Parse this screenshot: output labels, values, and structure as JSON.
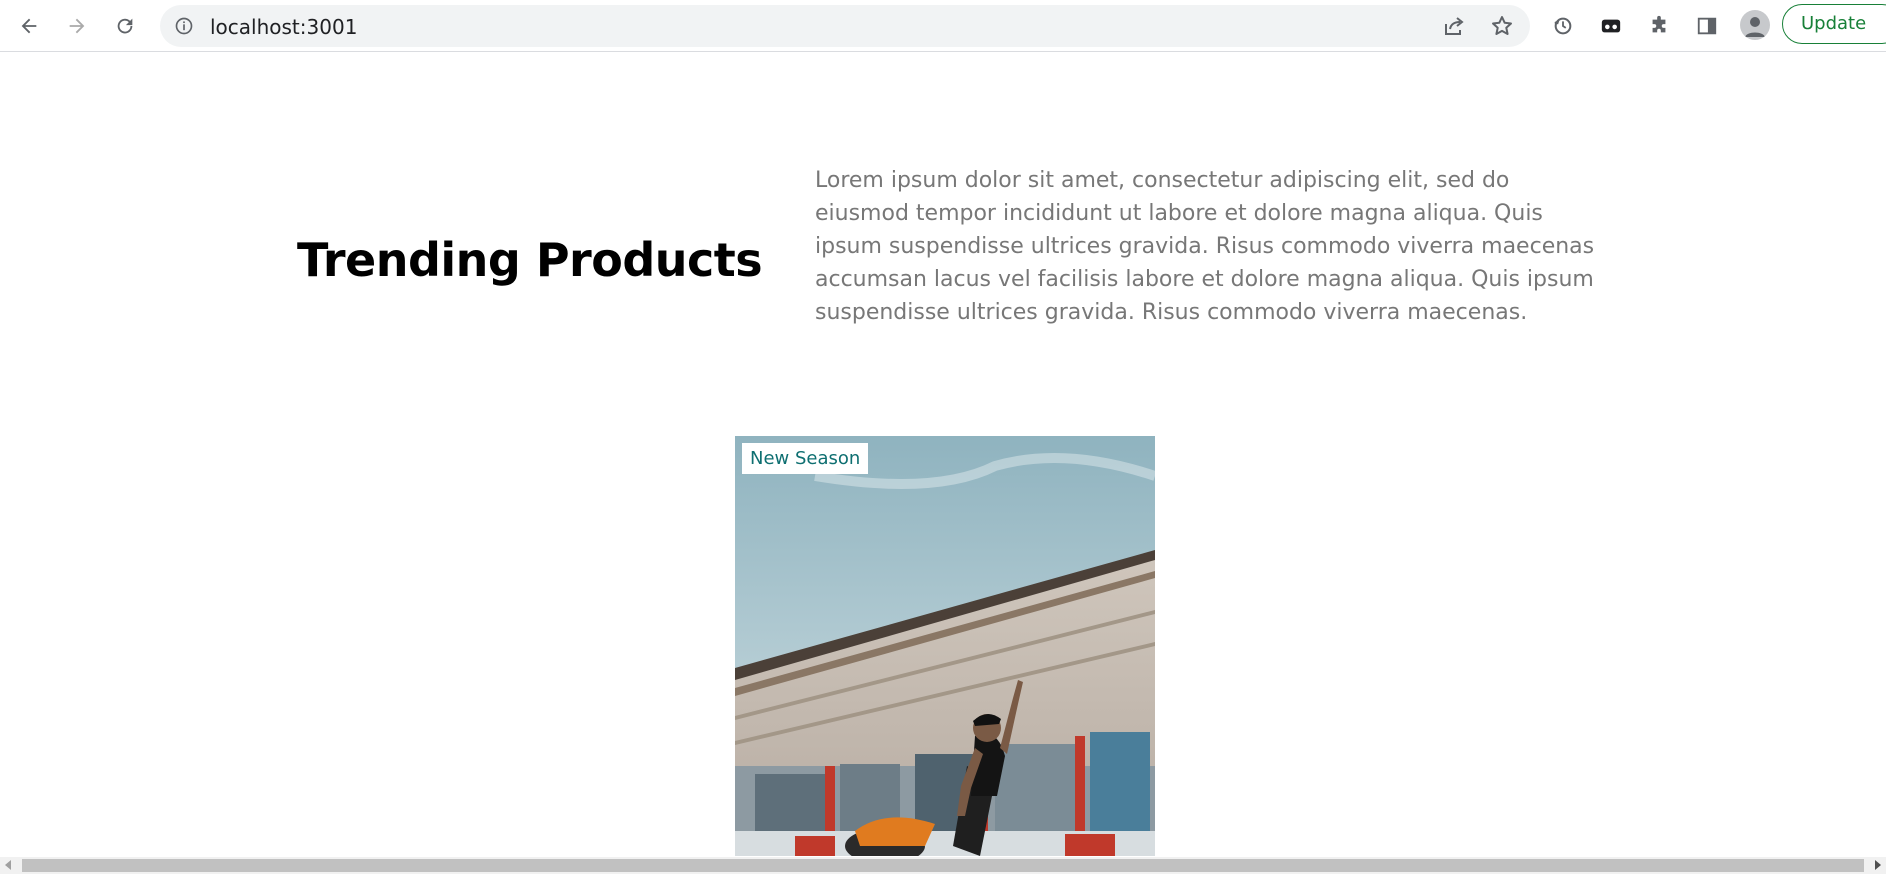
{
  "browser": {
    "url": "localhost:3001",
    "update_label": "Update"
  },
  "page": {
    "heading": "Trending Products",
    "description": "Lorem ipsum dolor sit amet, consectetur adipiscing elit, sed do eiusmod tempor incididunt ut labore et dolore magna aliqua. Quis ipsum suspendisse ultrices gravida. Risus commodo viverra maecenas accumsan lacus vel facilisis labore et dolore magna aliqua. Quis ipsum suspendisse ultrices gravida. Risus commodo viverra maecenas.",
    "products": [
      {
        "badge": "New Season"
      }
    ]
  },
  "colors": {
    "badge_text": "#0e6f71",
    "description_text": "#777777",
    "update_green": "#188038"
  },
  "icons": [
    "back-arrow-icon",
    "forward-arrow-icon",
    "reload-icon",
    "info-icon",
    "share-icon",
    "star-icon",
    "sync-icon",
    "extension-tab-icon",
    "puzzle-icon",
    "side-panel-icon",
    "profile-icon",
    "kebab-menu-icon"
  ]
}
